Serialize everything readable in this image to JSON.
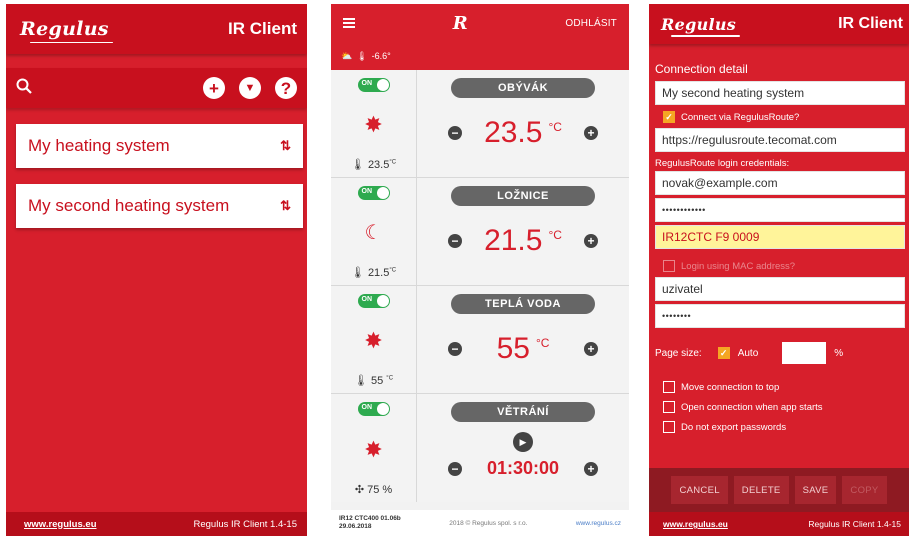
{
  "colors": {
    "brand_red": "#d71f2c",
    "dark_red": "#c8101e",
    "toggle_on": "#2eaa4f",
    "checkbox_on": "#f5a623",
    "highlight": "#fff49a"
  },
  "phone1": {
    "logo": "Regulus",
    "title": "IR Client",
    "toolbar_icons": [
      "search-icon",
      "add-icon",
      "download-icon",
      "help-icon"
    ],
    "connections": [
      {
        "name": "My heating system",
        "sort_icon": "sort-icon"
      },
      {
        "name": "My second heating system",
        "sort_icon": "sort-icon"
      }
    ],
    "footer": {
      "link": "www.regulus.eu",
      "version": "Regulus IR Client 1.4-15"
    }
  },
  "phone2": {
    "logout": "ODHLÁSIT",
    "outdoor_temp": "-6.6°",
    "toggle_label": "ON",
    "zones": [
      {
        "name": "OBÝVÁK",
        "current": "23.5",
        "current_unit": "°C",
        "setpoint": "23.5",
        "unit": "°C",
        "mode_icon": "sun-icon"
      },
      {
        "name": "LOŽNICE",
        "current": "21.5",
        "current_unit": "°C",
        "setpoint": "21.5",
        "unit": "°C",
        "mode_icon": "moon-icon"
      },
      {
        "name": "TEPLÁ VODA",
        "current": "55",
        "current_unit": "°C",
        "setpoint": "55",
        "unit": "°C",
        "mode_icon": "sun-icon"
      },
      {
        "name": "VĚTRÁNÍ",
        "current": "75 %",
        "setpoint": "01:30:00",
        "mode_icon": "sun-icon"
      }
    ],
    "footer": {
      "version_line1": "IR12 CTC400 01.06b",
      "version_line2": "29.06.2018",
      "copyright": "2018 © Regulus spol. s r.o.",
      "site": "www.regulus.cz"
    }
  },
  "phone3": {
    "logo": "Regulus",
    "title": "IR Client",
    "section_title": "Connection detail",
    "connection_name": "My second heating system",
    "via_route_label": "Connect via RegulusRoute?",
    "route_url": "https://regulusroute.tecomat.com",
    "credentials_label": "RegulusRoute login credentials:",
    "email": "novak@example.com",
    "password_mask": "••••••••••••",
    "device_id": "IR12CTC F9 0009",
    "mac_label": "Login using MAC address?",
    "username": "uzivatel",
    "user_password_mask": "••••••••",
    "page_size_label": "Page size:",
    "auto_label": "Auto",
    "percent": "%",
    "options": [
      "Move connection to top",
      "Open connection when app starts",
      "Do not export passwords"
    ],
    "buttons": {
      "cancel": "CANCEL",
      "delete": "DELETE",
      "save": "SAVE",
      "copy": "COPY"
    },
    "footer": {
      "link": "www.regulus.eu",
      "version": "Regulus IR Client 1.4-15"
    }
  }
}
